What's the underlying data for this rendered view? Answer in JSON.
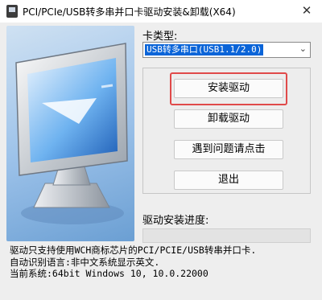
{
  "window": {
    "title": "PCI/PCIe/USB转多串并口卡驱动安装&卸载(X64)",
    "close_glyph": "✕"
  },
  "card_type": {
    "label": "卡类型:",
    "selected": "USB转多串口(USB1.1/2.0)"
  },
  "buttons": {
    "install": "安装驱动",
    "uninstall": "卸载驱动",
    "help": "遇到问题请点击",
    "exit": "退出"
  },
  "progress": {
    "label": "驱动安装进度:",
    "value": 0
  },
  "info": {
    "line1": "驱动只支持使用WCH商标芯片的PCI/PCIE/USB转串并口卡.",
    "line2": "自动识别语言:非中文系统显示英文.",
    "line3": "当前系统:64bit Windows 10, 10.0.22000"
  },
  "colors": {
    "highlight_border": "#e04a4a",
    "selection": "#0a64d8"
  },
  "icons": {
    "app": "driver-installer-icon",
    "art": "monitor-illustration",
    "dropdown": "chevron-down-icon"
  }
}
